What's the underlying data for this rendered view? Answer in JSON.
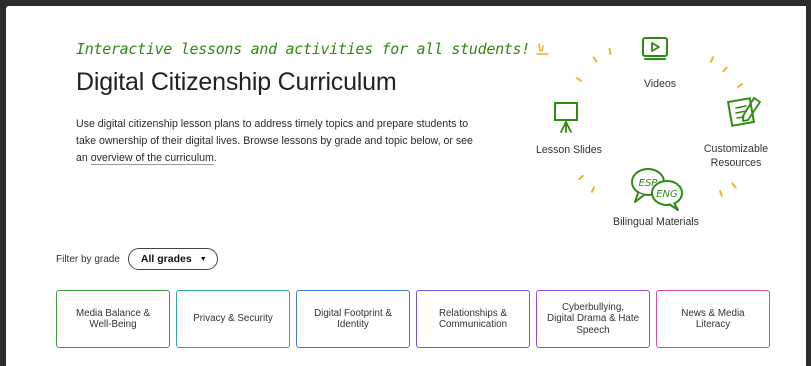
{
  "header": {
    "tagline": "Interactive lessons and activities for all students!",
    "title": "Digital Citizenship Curriculum",
    "description_text": "Use digital citizenship lesson plans to address timely topics and prepare students to take ownership of their digital lives. Browse lessons by grade and topic below, or see an ",
    "overview_link": "overview of the curriculum",
    "description_end": "."
  },
  "features": {
    "videos": "Videos",
    "lesson_slides": "Lesson Slides",
    "customizable_resources": "Customizable Resources",
    "bilingual_materials": "Bilingual Materials",
    "esp_label": "ESP",
    "eng_label": "ENG"
  },
  "filter": {
    "label": "Filter by grade",
    "selected": "All grades"
  },
  "topics": [
    {
      "label": "Media Balance & Well-Being",
      "color": "#3fa33a"
    },
    {
      "label": "Privacy & Security",
      "color": "#2fa6a0"
    },
    {
      "label": "Digital Footprint & Identity",
      "color": "#3f7fd6"
    },
    {
      "label": "Relationships & Communication",
      "color": "#6a5fd6"
    },
    {
      "label": "Cyberbullying, Digital Drama & Hate Speech",
      "color": "#9a4fd0"
    },
    {
      "label": "News & Media Literacy",
      "color": "#d24f9b"
    }
  ],
  "colors": {
    "accent_green": "#2f8a14",
    "ray_yellow": "#f0b428"
  }
}
